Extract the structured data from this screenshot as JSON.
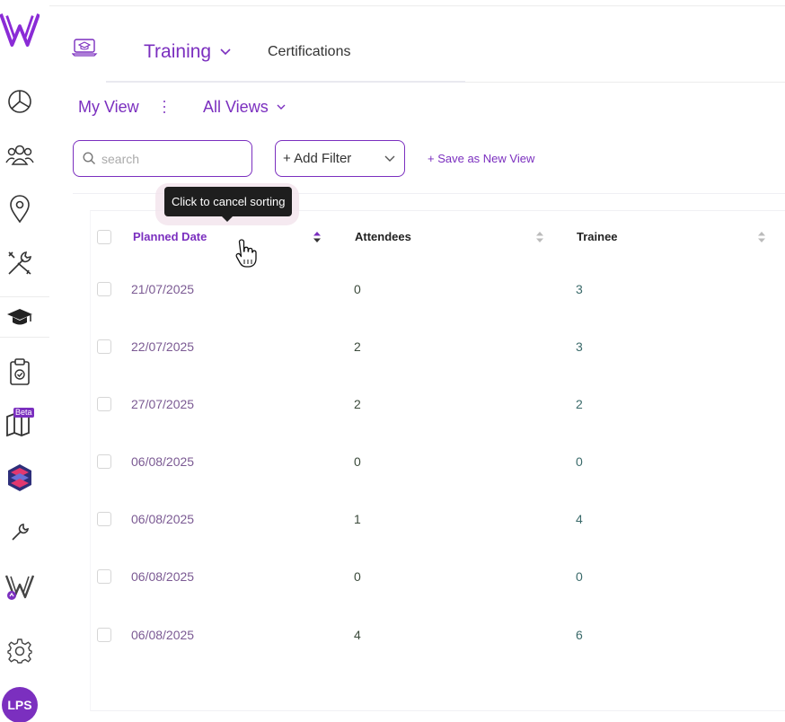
{
  "header": {
    "tabs": [
      {
        "label": "Training",
        "active": true
      },
      {
        "label": "Certifications",
        "active": false
      }
    ]
  },
  "views": {
    "current": "My View",
    "all_views_label": "All Views"
  },
  "filters": {
    "search_placeholder": "search",
    "add_filter_label": "+ Add Filter",
    "save_view_label": "+ Save as New View"
  },
  "tooltip": {
    "text": "Click to cancel sorting"
  },
  "table": {
    "columns": [
      {
        "label": "Planned Date",
        "sorted": true
      },
      {
        "label": "Attendees",
        "sorted": false
      },
      {
        "label": "Trainee",
        "sorted": false
      }
    ],
    "rows": [
      {
        "planned_date": "21/07/2025",
        "attendees": "0",
        "trainee": "3"
      },
      {
        "planned_date": "22/07/2025",
        "attendees": "2",
        "trainee": "3"
      },
      {
        "planned_date": "27/07/2025",
        "attendees": "2",
        "trainee": "2"
      },
      {
        "planned_date": "06/08/2025",
        "attendees": "0",
        "trainee": "0"
      },
      {
        "planned_date": "06/08/2025",
        "attendees": "1",
        "trainee": "4"
      },
      {
        "planned_date": "06/08/2025",
        "attendees": "0",
        "trainee": "0"
      },
      {
        "planned_date": "06/08/2025",
        "attendees": "4",
        "trainee": "6"
      }
    ]
  },
  "sidebar": {
    "beta_label": "Beta",
    "avatar_initials": "LPS",
    "icons": [
      "logo-icon",
      "analytics-icon",
      "people-icon",
      "location-icon",
      "tools-icon",
      "graduation-cap-icon",
      "clipboard-check-icon",
      "map-beta-icon",
      "layers-icon",
      "wrench-icon",
      "app-v-icon",
      "gear-icon"
    ]
  },
  "colors": {
    "accent": "#7b2fbf",
    "tooltip_bg": "#1e1e1e"
  }
}
